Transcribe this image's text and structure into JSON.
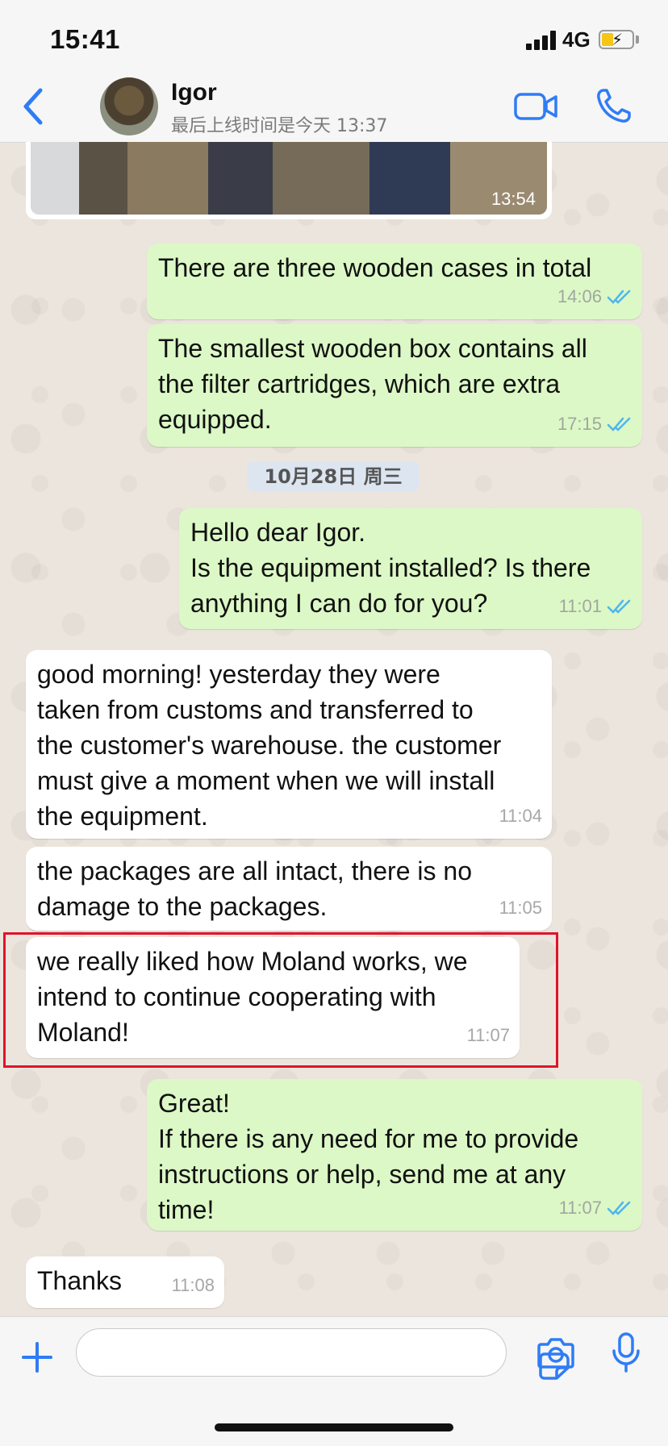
{
  "status": {
    "time": "15:41",
    "network": "4G"
  },
  "header": {
    "contact_name": "Igor",
    "last_seen": "最后上线时间是今天 13:37"
  },
  "image_message": {
    "time": "13:54"
  },
  "date_divider": "10月28日 周三",
  "messages": [
    {
      "direction": "out",
      "text": "There are three wooden cases in total",
      "time": "14:06",
      "read": true
    },
    {
      "direction": "out",
      "text": "The smallest wooden box contains all\nthe filter cartridges, which are extra\nequipped.",
      "time": "17:15",
      "read": true
    },
    {
      "direction": "out",
      "text": "Hello dear Igor.\nIs the equipment installed? Is there\nanything I can do for you?",
      "time": "11:01",
      "read": true
    },
    {
      "direction": "in",
      "text": "good morning! yesterday they were\ntaken from customs and transferred to\nthe customer's warehouse. the customer\nmust give a moment when we will install\nthe equipment.",
      "time": "11:04"
    },
    {
      "direction": "in",
      "text": "the packages are all intact, there is no\ndamage to the packages.",
      "time": "11:05"
    },
    {
      "direction": "in",
      "text": "we really liked how Moland works, we\nintend to continue cooperating with\nMoland!",
      "time": "11:07",
      "highlighted": true
    },
    {
      "direction": "out",
      "text": "Great!\nIf there is any need for me to provide\ninstructions or help, send me at any\ntime!",
      "time": "11:07",
      "read": true
    },
    {
      "direction": "in",
      "text": "Thanks",
      "time": "11:08"
    }
  ],
  "colors": {
    "accent": "#2f7cf6",
    "outgoing_bubble": "#dcf8c6",
    "incoming_bubble": "#ffffff",
    "read_ticks": "#4fb6ec",
    "highlight_box": "#e0142b"
  },
  "icons": {
    "header": [
      "back-chevron-icon",
      "video-call-icon",
      "phone-icon"
    ],
    "input": [
      "plus-icon",
      "sticker-icon",
      "camera-icon",
      "microphone-icon"
    ]
  }
}
